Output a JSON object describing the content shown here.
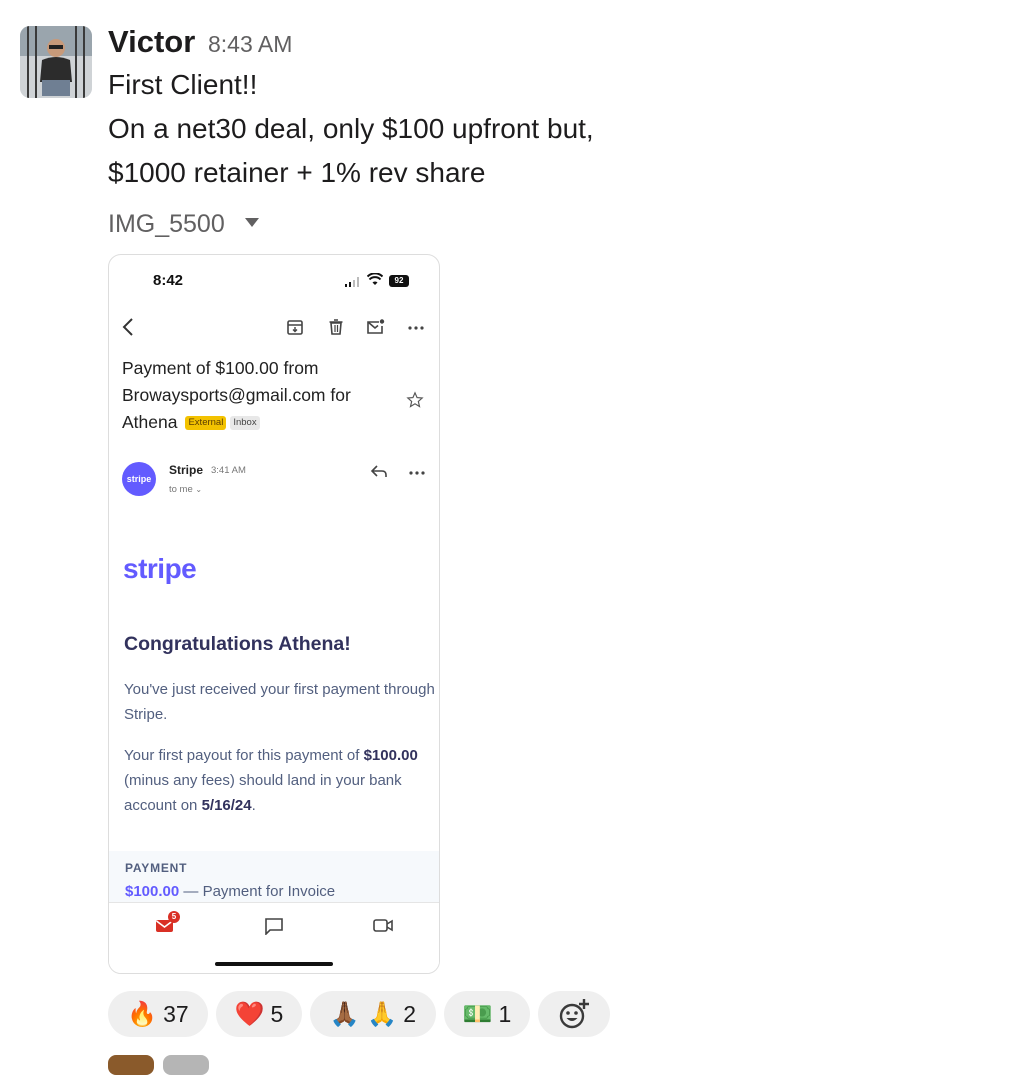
{
  "message": {
    "sender": "Victor",
    "time": "8:43 AM",
    "lines": [
      "First Client!!",
      "On a net30 deal, only $100 upfront but,",
      "$1000 retainer + 1% rev share"
    ],
    "file_name": "IMG_5500"
  },
  "screenshot": {
    "status_time": "8:42",
    "battery": "92",
    "subject": {
      "text": "Payment of $100.00 from Browaysports@gmail.com for Athena",
      "chip_external": "External",
      "chip_inbox": "Inbox"
    },
    "sender_badge": "stripe",
    "sender_name": "Stripe",
    "sender_time": "3:41 AM",
    "recipient": "to me",
    "logo": "stripe",
    "heading": "Congratulations Athena!",
    "para1": "You've just received your first payment through Stripe.",
    "para2": {
      "pre": "Your first payout for this payment of",
      "amount": "$100.00",
      "mid": "(minus any fees) should land in your bank account on",
      "date": "5/16/24",
      "post": "."
    },
    "payment_label": "PAYMENT",
    "payment_amount": "$100.00",
    "payment_desc": "— Payment for Invoice",
    "mail_badge": "5"
  },
  "reactions": [
    {
      "emoji": "🔥",
      "count": "37",
      "icon": "fire-icon"
    },
    {
      "emoji": "❤️",
      "count": "5",
      "icon": "heart-icon"
    },
    {
      "emoji": "🙏🏾 🙏",
      "count": "2",
      "icon": "pray-icon"
    },
    {
      "emoji": "💵",
      "count": "1",
      "icon": "dollar-banknote-icon"
    }
  ],
  "add_reaction_icon": "add-reaction-icon"
}
